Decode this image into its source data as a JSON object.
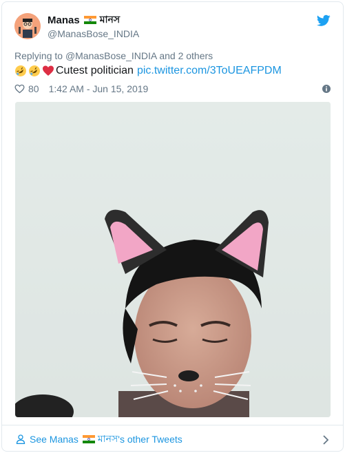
{
  "tweet": {
    "author": {
      "display_name": "Manas",
      "bengali_name": "মানস",
      "handle": "@ManasBose_INDIA",
      "avatar_icon": "avatar-illustration-icon",
      "flag_icon": "india-flag-icon"
    },
    "reply_prefix": "Replying to",
    "reply_mention": "@ManasBose_INDIA",
    "reply_suffix": "and 2 others",
    "emojis": [
      "rolling-on-floor-laughing-icon",
      "rolling-on-floor-laughing-icon",
      "red-heart-icon"
    ],
    "text": "Cutest politician",
    "link": "pic.twitter.com/3ToUEAFPDM",
    "likes": "80",
    "timestamp": "1:42 AM - Jun 15, 2019"
  },
  "footer": {
    "see_prefix": "See Manas",
    "see_bengali": "মানস",
    "see_suffix": "'s other Tweets"
  },
  "colors": {
    "link": "#1b95e0",
    "muted": "#657786",
    "twitter_blue": "#1da1f2"
  }
}
